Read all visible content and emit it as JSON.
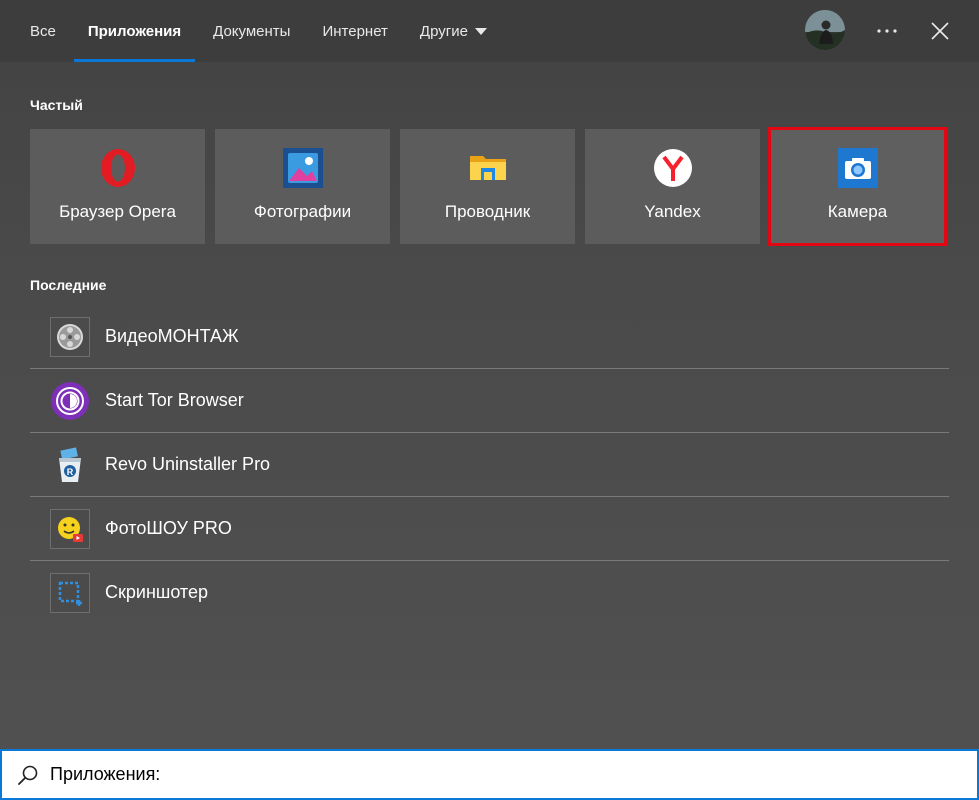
{
  "header": {
    "tabs": [
      {
        "label": "Все",
        "active": false
      },
      {
        "label": "Приложения",
        "active": true
      },
      {
        "label": "Документы",
        "active": false
      },
      {
        "label": "Интернет",
        "active": false
      },
      {
        "label": "Другие",
        "active": false,
        "has_dropdown": true
      }
    ],
    "avatar_icon": "user-avatar",
    "more_icon": "more-horizontal-icon",
    "close_icon": "close-icon"
  },
  "frequent": {
    "title": "Частый",
    "items": [
      {
        "label": "Браузер Opera",
        "icon": "opera-icon"
      },
      {
        "label": "Фотографии",
        "icon": "photos-icon"
      },
      {
        "label": "Проводник",
        "icon": "file-explorer-icon"
      },
      {
        "label": "Yandex",
        "icon": "yandex-icon"
      },
      {
        "label": "Камера",
        "icon": "camera-icon",
        "highlighted": true
      }
    ]
  },
  "recent": {
    "title": "Последние",
    "items": [
      {
        "label": "ВидеоМОНТАЖ",
        "icon": "film-reel-icon"
      },
      {
        "label": "Start Tor Browser",
        "icon": "tor-browser-icon"
      },
      {
        "label": "Revo Uninstaller Pro",
        "icon": "revo-uninstaller-icon"
      },
      {
        "label": "ФотоШОУ PRO",
        "icon": "fotoshow-icon"
      },
      {
        "label": "Скриншотер",
        "icon": "screenshot-icon"
      }
    ]
  },
  "search": {
    "value": "Приложения:",
    "icon": "search-icon"
  },
  "colors": {
    "accent": "#0a78d7",
    "highlight_border": "#e30613",
    "background": "#4a4a4a",
    "tile": "#5c5c5c"
  }
}
